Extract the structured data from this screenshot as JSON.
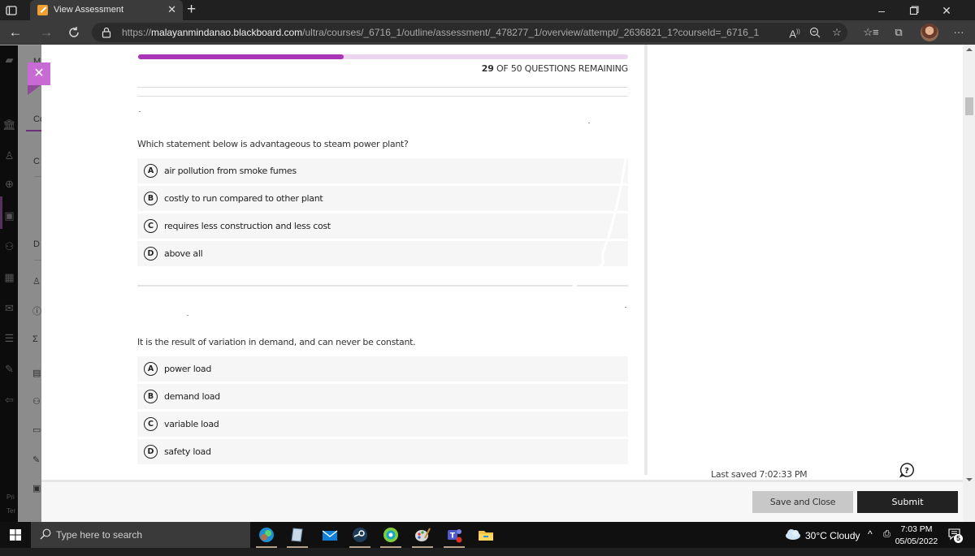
{
  "browser": {
    "tab_title": "View Assessment",
    "url_prefix": "https://",
    "url_host": "malayanmindanao.blackboard.com",
    "url_path": "/ultra/courses/_6716_1/outline/assessment/_478277_1/overview/attempt/_2636821_1?courseId=_6716_1",
    "icons": [
      "tab-actions-icon",
      "close-tab-icon",
      "new-tab-icon",
      "back-icon",
      "forward-icon",
      "refresh-icon",
      "lock-icon",
      "read-aloud-icon",
      "zoom-out-icon",
      "add-favorite-icon",
      "favorites-icon",
      "collections-icon",
      "profile-avatar",
      "more-icon",
      "minimize-icon",
      "maximize-icon",
      "close-window-icon"
    ]
  },
  "background_nav": {
    "letters": [
      "M",
      "Co",
      "C",
      "D"
    ],
    "footer": [
      "Pri",
      "Ter"
    ]
  },
  "assessment": {
    "progress": {
      "remaining": "29",
      "remaining_suffix": "OF 50 QUESTIONS REMAINING",
      "answered": 21,
      "total": 50,
      "fraction_complete": 0.42,
      "fill_color": "#a835b5",
      "track_color": "#ecd3ef"
    },
    "questions": [
      {
        "text": "Which statement below is advantageous to steam power plant?",
        "options": [
          {
            "letter": "A",
            "label": "air pollution from smoke fumes"
          },
          {
            "letter": "B",
            "label": "costly to run compared to other plant"
          },
          {
            "letter": "C",
            "label": "requires less construction and less cost"
          },
          {
            "letter": "D",
            "label": "above all"
          }
        ]
      },
      {
        "text": "It is the result of variation in demand, and can never be constant.",
        "options": [
          {
            "letter": "A",
            "label": "power load"
          },
          {
            "letter": "B",
            "label": "demand load"
          },
          {
            "letter": "C",
            "label": "variable load"
          },
          {
            "letter": "D",
            "label": "safety load"
          }
        ]
      }
    ],
    "last_saved": "Last saved 7:02:33 PM",
    "save_close_label": "Save and Close",
    "submit_label": "Submit",
    "accent_close_color": "#c86ad3"
  },
  "taskbar": {
    "search_placeholder": "Type here to search",
    "apps": [
      "edge",
      "notepad",
      "mail",
      "steam",
      "browser-green",
      "paint",
      "teams",
      "file-explorer"
    ],
    "weather": "30°C  Cloudy",
    "time": "7:03 PM",
    "date": "05/05/2022",
    "notification_count": "5"
  }
}
